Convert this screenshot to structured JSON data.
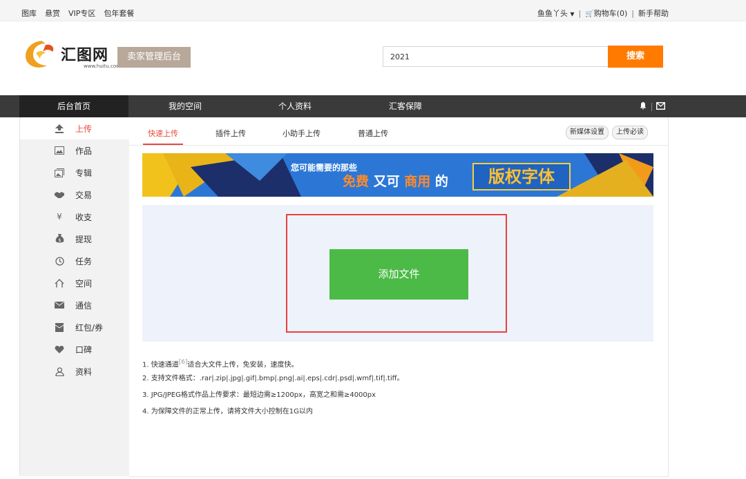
{
  "topbar": {
    "links": [
      "图库",
      "悬赏",
      "VIP专区",
      "包年套餐"
    ],
    "user": "鱼鱼丫头",
    "cart": "购物车(0)",
    "help": "新手帮助"
  },
  "header": {
    "logo_text": "汇图网",
    "logo_sub": "www.huitu.com",
    "seller_btn": "卖家管理后台",
    "search_value": "2021",
    "search_btn": "搜索"
  },
  "nav": {
    "home": "后台首页",
    "items": [
      "我的空间",
      "个人资料",
      "汇客保障"
    ]
  },
  "sidebar": {
    "items": [
      {
        "label": "上传",
        "icon": "upload-icon"
      },
      {
        "label": "作品",
        "icon": "image-icon"
      },
      {
        "label": "专辑",
        "icon": "album-icon"
      },
      {
        "label": "交易",
        "icon": "handshake-icon"
      },
      {
        "label": "收支",
        "icon": "yen-icon"
      },
      {
        "label": "提现",
        "icon": "money-bag-icon"
      },
      {
        "label": "任务",
        "icon": "clock-icon"
      },
      {
        "label": "空间",
        "icon": "home-icon"
      },
      {
        "label": "通信",
        "icon": "mail-icon"
      },
      {
        "label": "红包/券",
        "icon": "redpacket-icon"
      },
      {
        "label": "口碑",
        "icon": "reputation-icon"
      },
      {
        "label": "资料",
        "icon": "user-icon"
      }
    ]
  },
  "tabs": [
    "快速上传",
    "插件上传",
    "小助手上传",
    "普通上传"
  ],
  "pills": [
    "新媒体设置",
    "上传必读"
  ],
  "banner": {
    "line1": "您可能需要的那些",
    "w1": "免费",
    "w2": "又可",
    "w3": "商用",
    "w4": "的",
    "box": "版权字体"
  },
  "upload": {
    "button": "添加文件"
  },
  "notes": {
    "n1_pre": "1. 快速通道",
    "n1_sup": "[6]",
    "n1_post": "适合大文件上传，免安装，速度快。",
    "n2": "2. 支持文件格式：.rar|.zip|.jpg|.gif|.bmp|.png|.ai|.eps|.cdr|.psd|.wmf|.tif|.tiff。",
    "n3": "3. JPG/JPEG格式作品上传要求：最短边需≥1200px，高宽之和需≥4000px",
    "n4": "4. 为保障文件的正常上传，请将文件大小控制在1G以内"
  },
  "colors": {
    "accent": "#e84a3b",
    "search_btn": "#ff7a00",
    "add_btn": "#4cba47",
    "nav_bg": "#3a3a3a"
  }
}
